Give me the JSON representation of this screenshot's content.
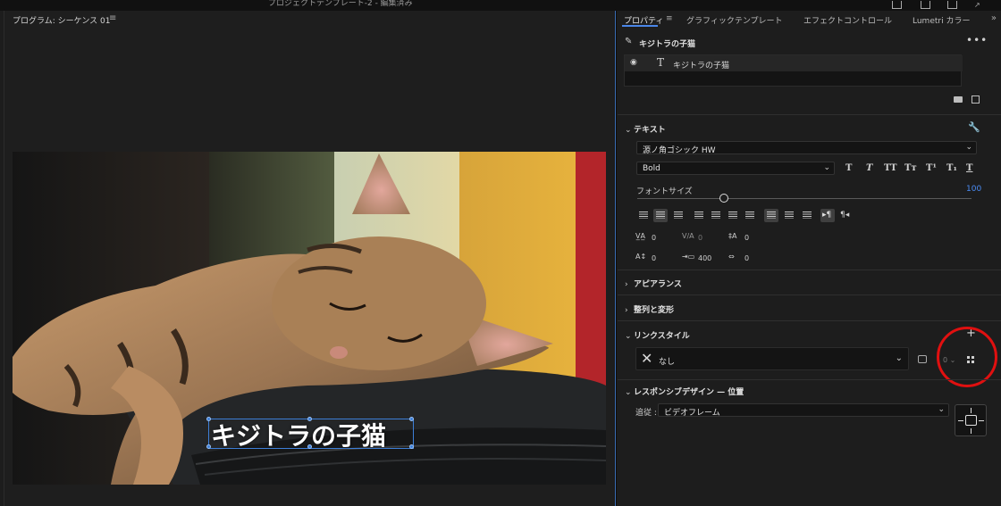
{
  "window": {
    "title": "プロジェクトテンプレート-2 - 編集済み"
  },
  "monitor": {
    "tab_label": "プログラム: シーケンス 01",
    "menu_icon": "hamburger-icon",
    "overlay_title": "キジトラの子猫"
  },
  "panel": {
    "tabs": [
      {
        "label": "プロパティ",
        "active": true
      },
      {
        "label": "グラフィックテンプレート",
        "active": false
      },
      {
        "label": "エフェクトコントロール",
        "active": false
      },
      {
        "label": "Lumetri カラー",
        "active": false
      }
    ],
    "tab_menu_icon": "hamburger-icon",
    "expand_icon": "double-chevron-right-icon",
    "clip": {
      "name": "キジトラの子猫",
      "icon": "graphic-pen-icon",
      "more_icon": "more-dots-icon"
    },
    "layers": [
      {
        "name": "キジトラの子猫",
        "icon": "text-layer-icon",
        "visible": true
      }
    ]
  },
  "text_section": {
    "header": "テキスト",
    "font_family": "源ノ角ゴシック HW",
    "font_style": "Bold",
    "style_buttons": [
      "T",
      "T",
      "TT",
      "Tт",
      "T¹",
      "T₁",
      "T"
    ],
    "font_size_label": "フォントサイズ",
    "font_size": "100",
    "font_size_fraction": 0.26,
    "kerning": "0",
    "tracking": "0",
    "leading": "0",
    "baseline_shift": "0",
    "tsume": "400",
    "tab_width": "0"
  },
  "sections": {
    "appearance": "アピアランス",
    "align_transform": "整列と変形",
    "linked_style": "リンクスタイル",
    "responsive": "レスポンシブデザイン — 位置"
  },
  "linked_style": {
    "value": "なし",
    "count": "0",
    "add_icon": "plus-icon"
  },
  "responsive": {
    "follow_label": "追従 :",
    "follow_value": "ビデオフレーム"
  },
  "colors": {
    "accent": "#4b8cf5",
    "highlight_circle": "#e01010"
  }
}
